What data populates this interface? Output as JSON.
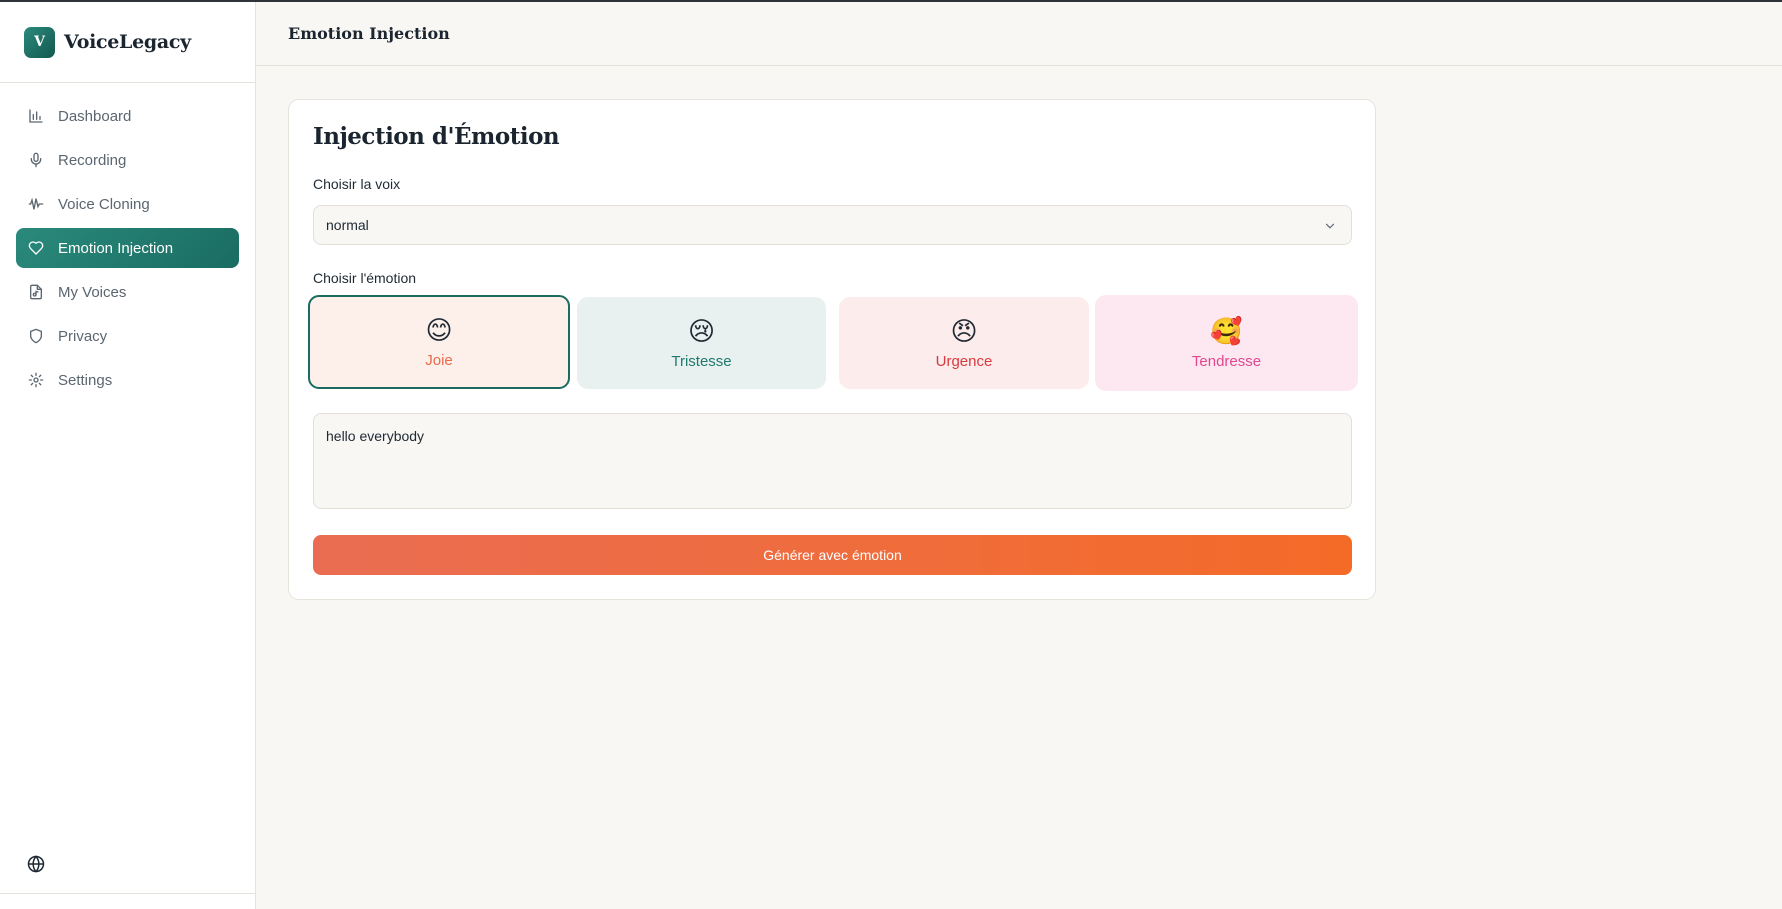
{
  "brand": {
    "logo_letter": "V",
    "name": "VoiceLegacy"
  },
  "sidebar": {
    "items": [
      {
        "label": "Dashboard",
        "icon": "bar-chart-icon"
      },
      {
        "label": "Recording",
        "icon": "microphone-icon"
      },
      {
        "label": "Voice Cloning",
        "icon": "audio-wave-icon"
      },
      {
        "label": "Emotion Injection",
        "icon": "heart-icon",
        "active": true
      },
      {
        "label": "My Voices",
        "icon": "file-audio-icon"
      },
      {
        "label": "Privacy",
        "icon": "shield-icon"
      },
      {
        "label": "Settings",
        "icon": "gear-icon"
      }
    ],
    "footer_icon": "globe-icon"
  },
  "header": {
    "title": "Emotion Injection"
  },
  "card": {
    "title": "Injection d'Émotion",
    "voice_label": "Choisir la voix",
    "voice_selected": "normal",
    "emotion_label": "Choisir l'émotion",
    "emotions": [
      {
        "emoji": "😊",
        "label": "Joie",
        "selected": true
      },
      {
        "emoji": "😢",
        "label": "Tristesse"
      },
      {
        "emoji": "😠",
        "label": "Urgence"
      },
      {
        "emoji": "🥰",
        "label": "Tendresse"
      }
    ],
    "text_value": "hello everybody",
    "generate_label": "Générer avec émotion"
  },
  "colors": {
    "accent": "#1a6c61",
    "button_start": "#ea6d53",
    "button_end": "#f46b28",
    "background": "#f8f7f4"
  }
}
